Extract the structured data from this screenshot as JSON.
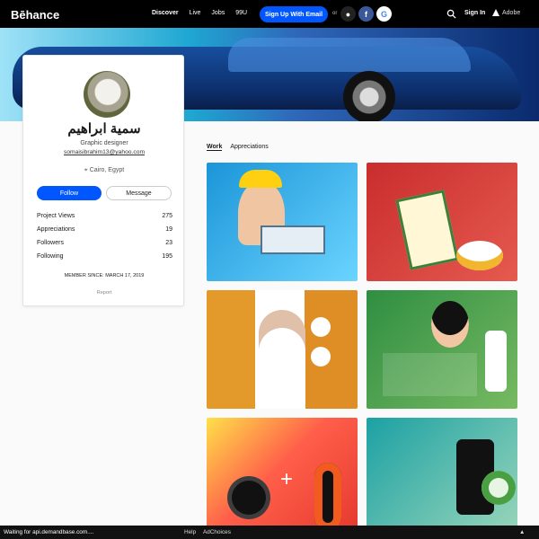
{
  "header": {
    "logo": "Bēhance",
    "nav": [
      "Discover",
      "Live",
      "Jobs",
      "99U"
    ],
    "signup_label": "Sign Up With Email",
    "or_label": "or",
    "social": [
      "apple-icon",
      "facebook-icon",
      "google-icon"
    ],
    "signin_label": "Sign In",
    "adobe_label": "Adobe"
  },
  "profile": {
    "name": "سمية ابراهيم",
    "title": "Graphic designer",
    "email": "somaisibrahim13@yahoo.com",
    "location": "Cairo, Egypt",
    "follow_label": "Follow",
    "message_label": "Message",
    "stats": [
      {
        "label": "Project Views",
        "value": "275"
      },
      {
        "label": "Appreciations",
        "value": "19"
      },
      {
        "label": "Followers",
        "value": "23"
      },
      {
        "label": "Following",
        "value": "195"
      }
    ],
    "member_since": "MEMBER SINCE: MARCH 17, 2019",
    "report_label": "Report"
  },
  "tabs": [
    "Work",
    "Appreciations"
  ],
  "footer": {
    "status": "Waiting for api.demandbase.com....",
    "help": "Help",
    "adchoices": "AdChoices"
  },
  "colors": {
    "brand_blue": "#0057ff",
    "topbar": "#000000"
  }
}
